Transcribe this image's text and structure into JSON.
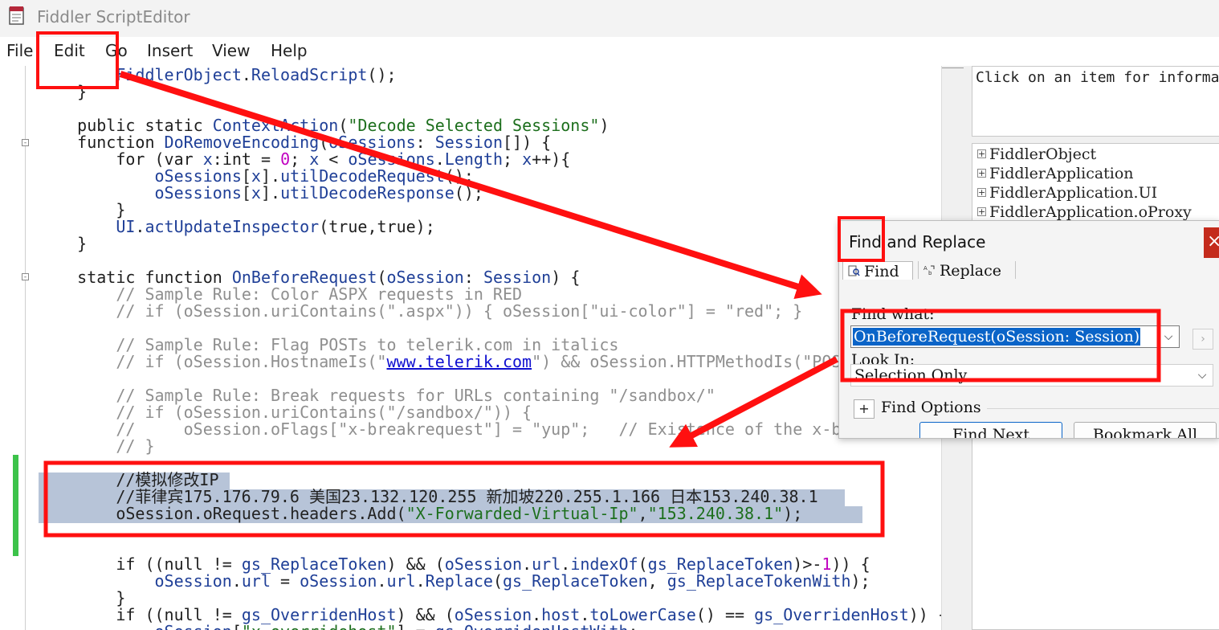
{
  "window": {
    "title": "Fiddler ScriptEditor"
  },
  "menu": {
    "file": "File",
    "edit": "Edit",
    "go": "Go",
    "insert": "Insert",
    "view": "View",
    "help": "Help"
  },
  "info_panel": {
    "text": "Click on an item for informa"
  },
  "object_tree": {
    "expander": "+",
    "items": [
      "FiddlerObject",
      "FiddlerApplication",
      "FiddlerApplication.UI",
      "FiddlerApplication.oProxy"
    ]
  },
  "find_dialog": {
    "title": "Find and Replace",
    "close": "×",
    "tabs": {
      "find": "Find",
      "replace": "Replace"
    },
    "find_what_label": "Find what:",
    "find_what_value": "OnBeforeRequest(oSession: Session)",
    "look_in_label": "Look In:",
    "look_in_value": "Selection Only",
    "options_toggle": "+",
    "options_label": "Find Options",
    "buttons": {
      "find_next": "Find Next",
      "bookmark_all": "Bookmark All"
    }
  },
  "colors": {
    "annotation": "#ff1010",
    "selection": "#b7c4d8",
    "change_bar": "#3cc34a",
    "find_highlight": "#0a64c8"
  }
}
